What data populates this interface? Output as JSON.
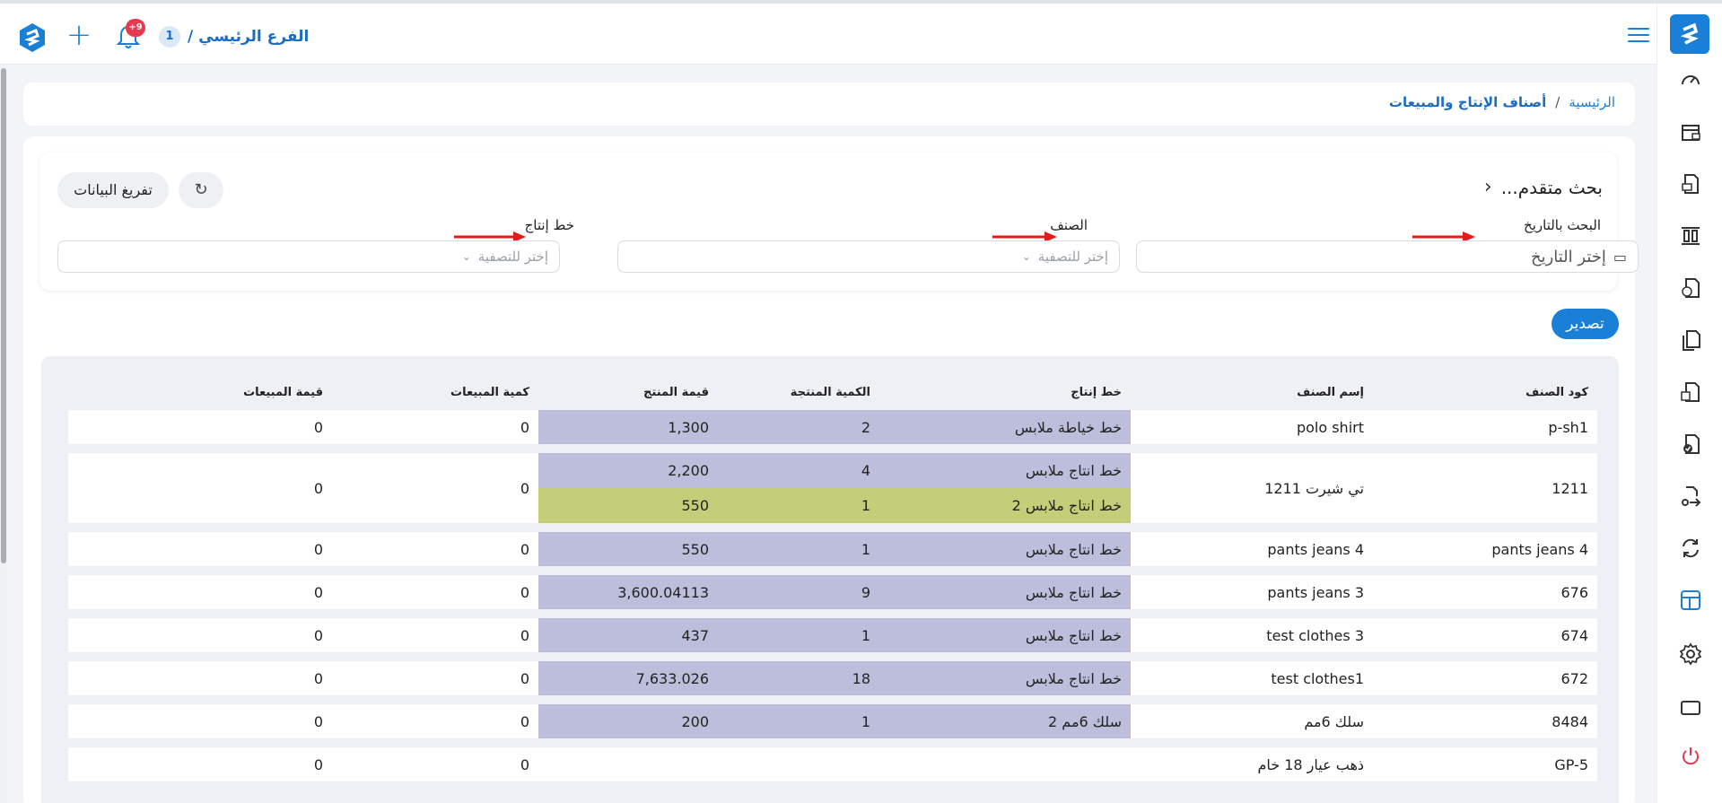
{
  "header": {
    "branch_number": "1",
    "branch_name": "الفرع الرئيسي /",
    "notification_badge": "+9"
  },
  "breadcrumb": {
    "home": "الرئيسية",
    "separator": "/",
    "current": "أصناف الإنتاج والمبيعات"
  },
  "search": {
    "title": "بحث متقدم...",
    "clear_label": "تفريغ البيانات",
    "date_label": "البحث بالتاريخ",
    "date_placeholder": "إختر التاريخ",
    "category_label": "الصنف",
    "category_placeholder": "إختر للتصفية",
    "line_label": "خط إنتاج",
    "line_placeholder": "إختر للتصفية"
  },
  "export_label": "تصدير",
  "table": {
    "headers": {
      "code": "كود الصنف",
      "name": "إسم الصنف",
      "line": "خط إنتاج",
      "produced_qty": "الكمية المنتجة",
      "product_value": "قيمة المنتج",
      "sales_qty": "كمية المبيعات",
      "sales_value": "قيمة المبيعات"
    },
    "rows": [
      {
        "code": "p-sh1",
        "name": "polo shirt",
        "lines": [
          {
            "line": "خط خياطة ملابس",
            "qty": "2",
            "value": "1,300"
          }
        ],
        "sales_qty": "0",
        "sales_value": "0"
      },
      {
        "code": "1211",
        "name": "تي شيرت 1211",
        "lines": [
          {
            "line": "خط انتاج ملابس",
            "qty": "4",
            "value": "2,200"
          },
          {
            "line": "خط انتاج ملابس 2",
            "qty": "1",
            "value": "550"
          }
        ],
        "sales_qty": "0",
        "sales_value": "0"
      },
      {
        "code": "pants jeans 4",
        "name": "pants jeans 4",
        "lines": [
          {
            "line": "خط انتاج ملابس",
            "qty": "1",
            "value": "550"
          }
        ],
        "sales_qty": "0",
        "sales_value": "0"
      },
      {
        "code": "676",
        "name": "pants jeans 3",
        "lines": [
          {
            "line": "خط انتاج ملابس",
            "qty": "9",
            "value": "3,600.04113"
          }
        ],
        "sales_qty": "0",
        "sales_value": "0"
      },
      {
        "code": "674",
        "name": "test clothes 3",
        "lines": [
          {
            "line": "خط انتاج ملابس",
            "qty": "1",
            "value": "437"
          }
        ],
        "sales_qty": "0",
        "sales_value": "0"
      },
      {
        "code": "672",
        "name": "test clothes1",
        "lines": [
          {
            "line": "خط انتاج ملابس",
            "qty": "18",
            "value": "7,633.026"
          }
        ],
        "sales_qty": "0",
        "sales_value": "0"
      },
      {
        "code": "8484",
        "name": "سلك 6مم",
        "lines": [
          {
            "line": "سلك 6مم 2",
            "qty": "1",
            "value": "200"
          }
        ],
        "sales_qty": "0",
        "sales_value": "0"
      },
      {
        "code": "GP-5",
        "name": "ذهب عيار 18 خام",
        "lines": [],
        "sales_qty": "0",
        "sales_value": "0"
      }
    ]
  },
  "colors": {
    "accent": "#1a7fd6",
    "production_cell": "#bcbedb",
    "production_cell_alt": "#c4ce78",
    "badge": "#e53950"
  },
  "icons": [
    "dashboard-icon",
    "store-icon",
    "invoice-icon",
    "columns-icon",
    "document-exchange-icon",
    "documents-icon",
    "boxes-icon",
    "document-check-icon",
    "transfer-icon",
    "sync-icon",
    "layout-icon",
    "gear-icon",
    "screen-icon",
    "power-icon"
  ]
}
